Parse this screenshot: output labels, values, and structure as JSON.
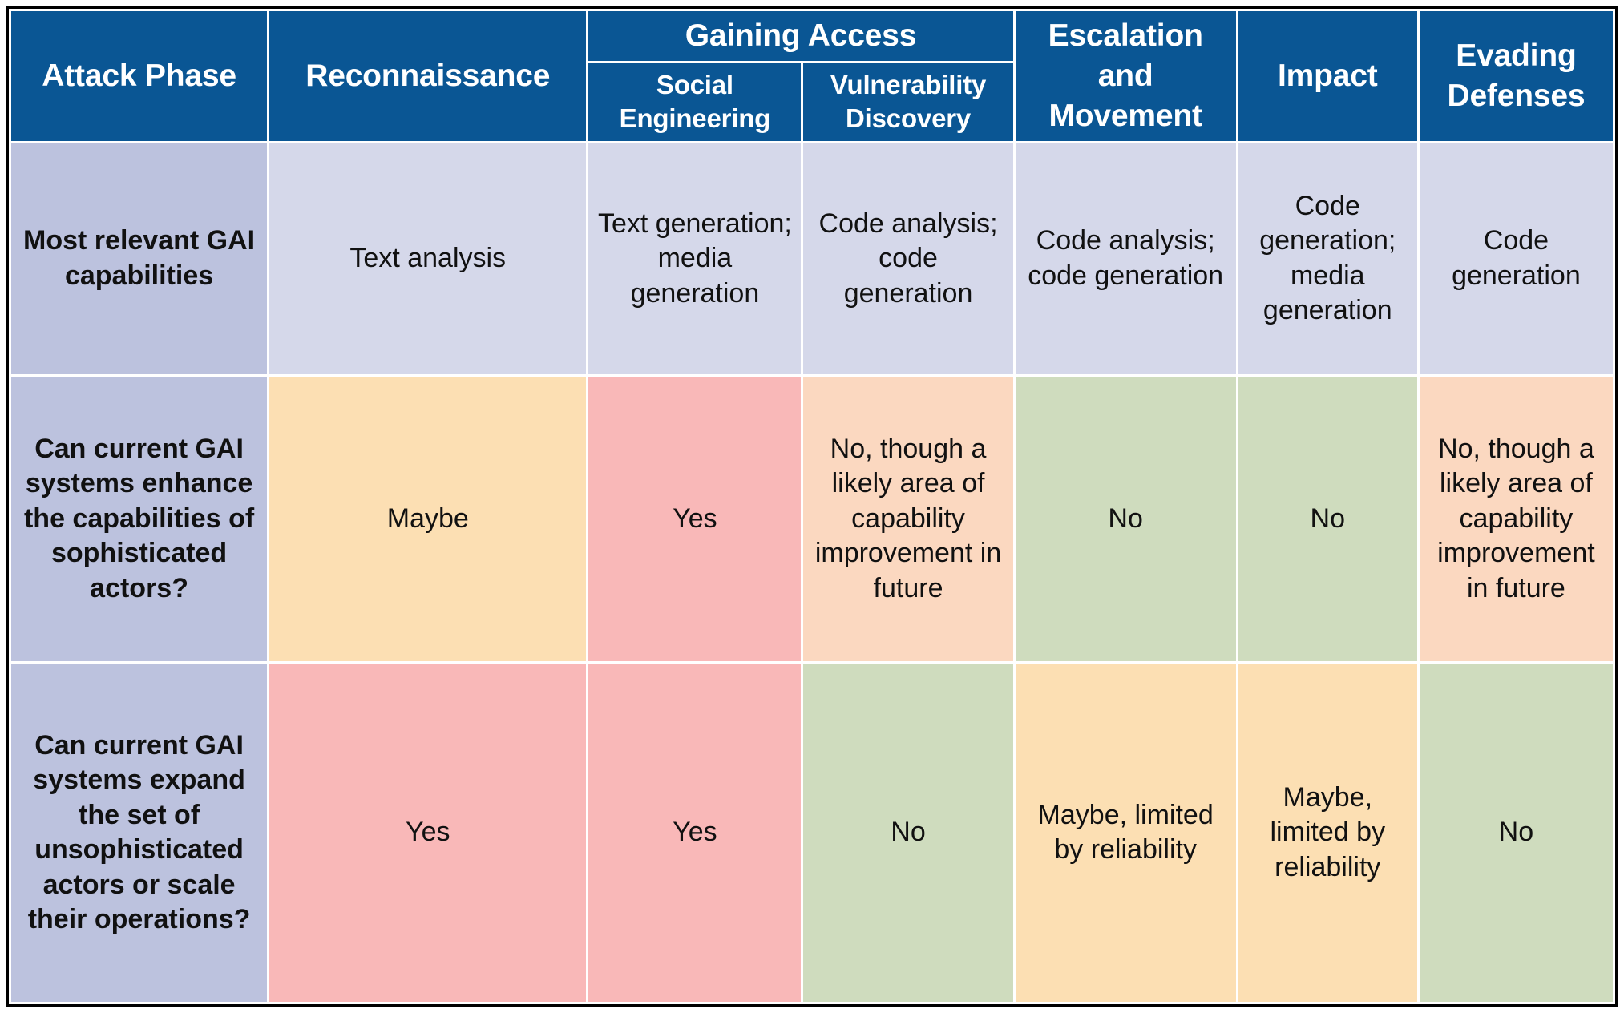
{
  "table": {
    "colors": {
      "header_blue": "#0A5694",
      "row_label_lavender": "#BCC2DE",
      "capability_lavender": "#D5D8EA",
      "yes_red": "#F9B8B8",
      "maybe_orange": "#FCDFB3",
      "no_green": "#CFDCBE",
      "no_future_peach": "#FBD8C0",
      "grid_line": "#FFFFFF",
      "outer_border": "#000000"
    },
    "header": {
      "corner_label": "Attack Phase",
      "columns": [
        {
          "label": "Reconnaissance",
          "type": "simple"
        },
        {
          "label": "Gaining Access",
          "type": "group",
          "children": [
            "Social Engineering",
            "Vulnerability Discovery"
          ]
        },
        {
          "label": "Escalation and Movement",
          "type": "simple"
        },
        {
          "label": "Impact",
          "type": "simple"
        },
        {
          "label": "Evading Defenses",
          "type": "simple"
        }
      ]
    },
    "rows": [
      {
        "label": "Most relevant GAI capabilities",
        "cells": [
          {
            "text": "Text analysis",
            "style": "capability"
          },
          {
            "text": "Text generation; media generation",
            "style": "capability"
          },
          {
            "text": "Code analysis; code generation",
            "style": "capability"
          },
          {
            "text": "Code analysis; code generation",
            "style": "capability"
          },
          {
            "text": "Code generation; media generation",
            "style": "capability"
          },
          {
            "text": "Code generation",
            "style": "capability"
          }
        ]
      },
      {
        "label": "Can current GAI systems enhance the capabilities of sophisticated actors?",
        "cells": [
          {
            "text": "Maybe",
            "style": "maybe"
          },
          {
            "text": "Yes",
            "style": "yes"
          },
          {
            "text": "No, though a likely area of capability improvement in future",
            "style": "no_future"
          },
          {
            "text": "No",
            "style": "no"
          },
          {
            "text": "No",
            "style": "no"
          },
          {
            "text": "No, though a likely area of capability improvement in future",
            "style": "no_future"
          }
        ]
      },
      {
        "label": "Can current GAI systems expand the set of unsophisticated actors or scale their operations?",
        "cells": [
          {
            "text": "Yes",
            "style": "yes"
          },
          {
            "text": "Yes",
            "style": "yes"
          },
          {
            "text": "No",
            "style": "no"
          },
          {
            "text": "Maybe, limited by reliability",
            "style": "maybe"
          },
          {
            "text": "Maybe, limited by reliability",
            "style": "maybe"
          },
          {
            "text": "No",
            "style": "no"
          }
        ]
      }
    ]
  }
}
